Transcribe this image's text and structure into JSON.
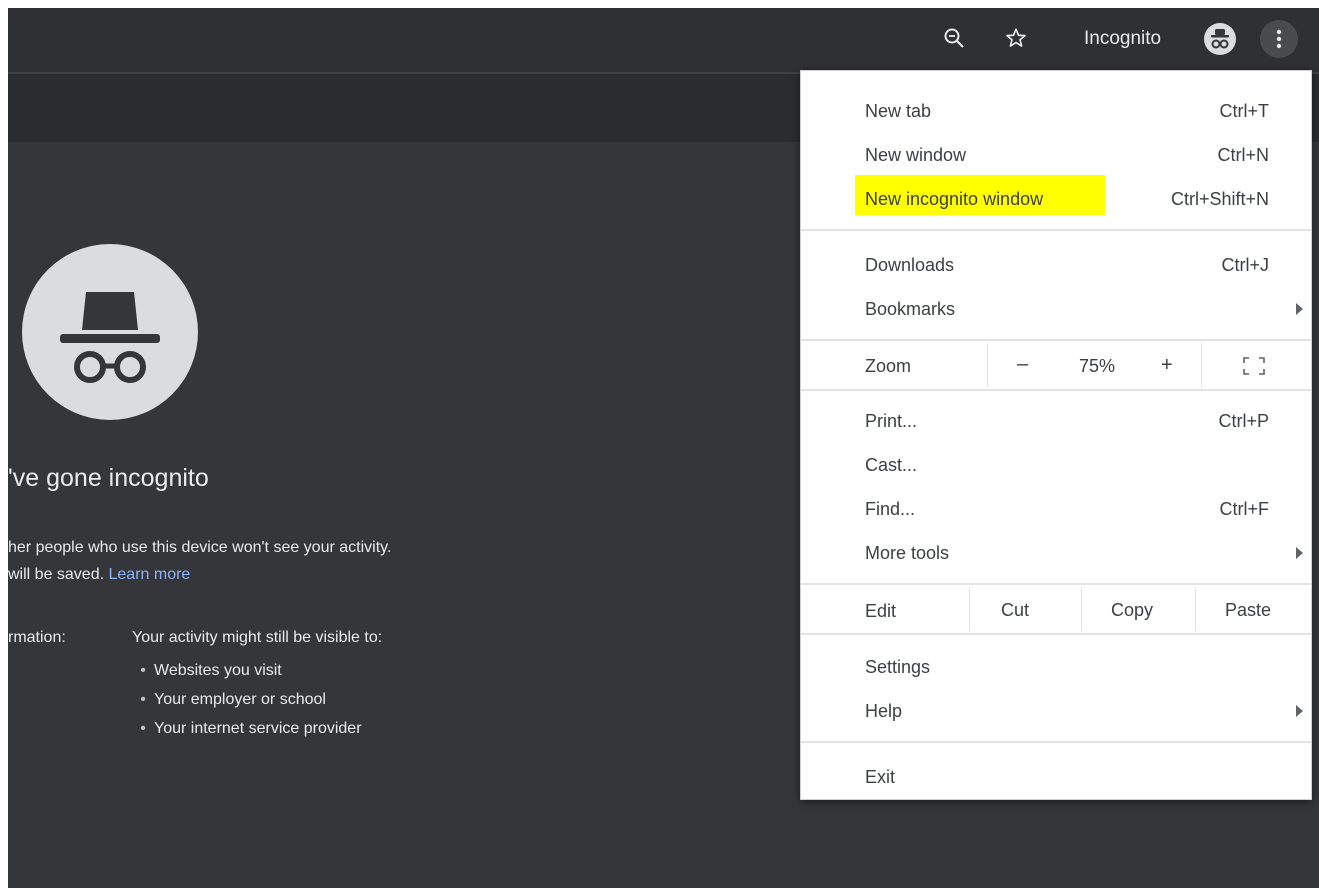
{
  "toolbar": {
    "zoom_icon": "zoom-icon",
    "star_icon": "star-icon",
    "incognito_label": "Incognito",
    "incognito_avatar_icon": "incognito-icon",
    "menu_icon": "more-vert-icon"
  },
  "page": {
    "heading": "'ve gone incognito",
    "line1": "her people who use this device won't see your activity.",
    "line2_prefix": "will be saved.",
    "learn_more": "Learn more",
    "info_label": "rmation:",
    "visible_heading": "Your activity might still be visible to:",
    "visible_items": [
      "Websites you visit",
      "Your employer or school",
      "Your internet service provider"
    ]
  },
  "menu": {
    "new_tab": {
      "label": "New tab",
      "shortcut": "Ctrl+T"
    },
    "new_window": {
      "label": "New window",
      "shortcut": "Ctrl+N"
    },
    "new_incognito": {
      "label": "New incognito window",
      "shortcut": "Ctrl+Shift+N",
      "highlight": "#ffff00"
    },
    "downloads": {
      "label": "Downloads",
      "shortcut": "Ctrl+J"
    },
    "bookmarks": {
      "label": "Bookmarks"
    },
    "zoom": {
      "label": "Zoom",
      "minus": "–",
      "value": "75%",
      "plus": "+",
      "fullscreen_icon": "fullscreen-icon"
    },
    "print": {
      "label": "Print...",
      "shortcut": "Ctrl+P"
    },
    "cast": {
      "label": "Cast..."
    },
    "find": {
      "label": "Find...",
      "shortcut": "Ctrl+F"
    },
    "more_tools": {
      "label": "More tools"
    },
    "edit": {
      "label": "Edit",
      "cut": "Cut",
      "copy": "Copy",
      "paste": "Paste"
    },
    "settings": {
      "label": "Settings"
    },
    "help": {
      "label": "Help"
    },
    "exit": {
      "label": "Exit"
    }
  }
}
